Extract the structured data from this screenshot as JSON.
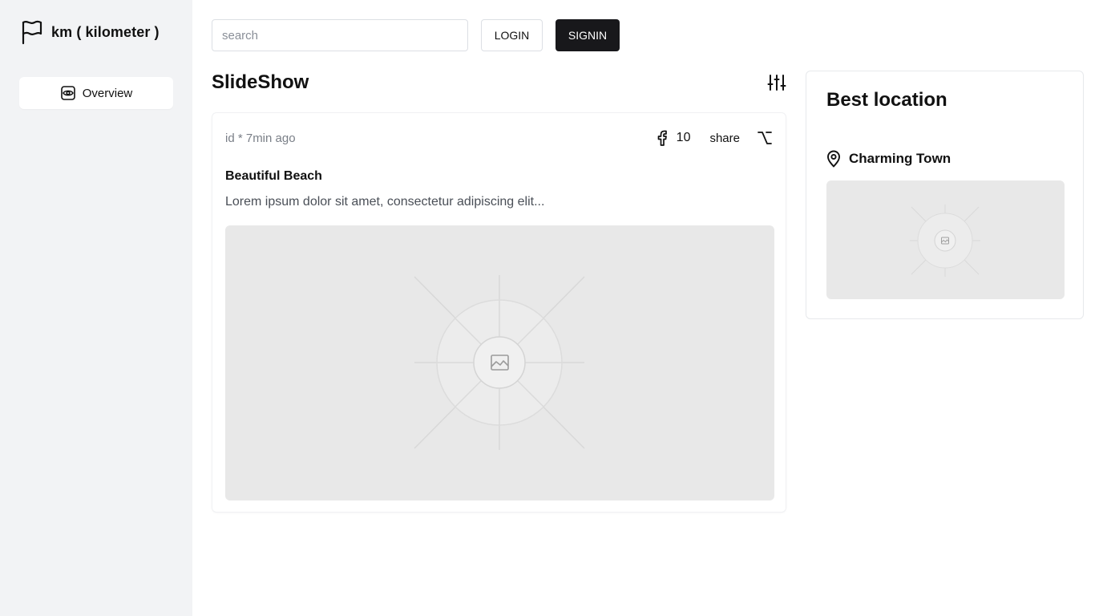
{
  "brand": {
    "name": "km ( kilometer )",
    "icon": "flag-icon"
  },
  "sidebar": {
    "items": [
      {
        "label": "Overview",
        "icon": "eye-icon"
      }
    ]
  },
  "topbar": {
    "search_placeholder": "search",
    "search_value": "",
    "login_label": "LOGIN",
    "signin_label": "SIGNIN"
  },
  "slideshow": {
    "title": "SlideShow",
    "filter_icon": "sliders-icon",
    "post": {
      "meta": "id * 7min ago",
      "likes": "10",
      "share_label": "share",
      "title": "Beautiful Beach",
      "description": "Lorem ipsum dolor sit amet, consectetur adipiscing elit...",
      "image_icon": "image-placeholder-icon"
    }
  },
  "best_location": {
    "title": "Best location",
    "place": "Charming Town",
    "pin_icon": "map-pin-icon",
    "image_icon": "image-placeholder-icon"
  },
  "colors": {
    "sidebar_bg": "#f2f3f5",
    "primary_button": "#18181b",
    "placeholder_bg": "#e8e8e8"
  }
}
